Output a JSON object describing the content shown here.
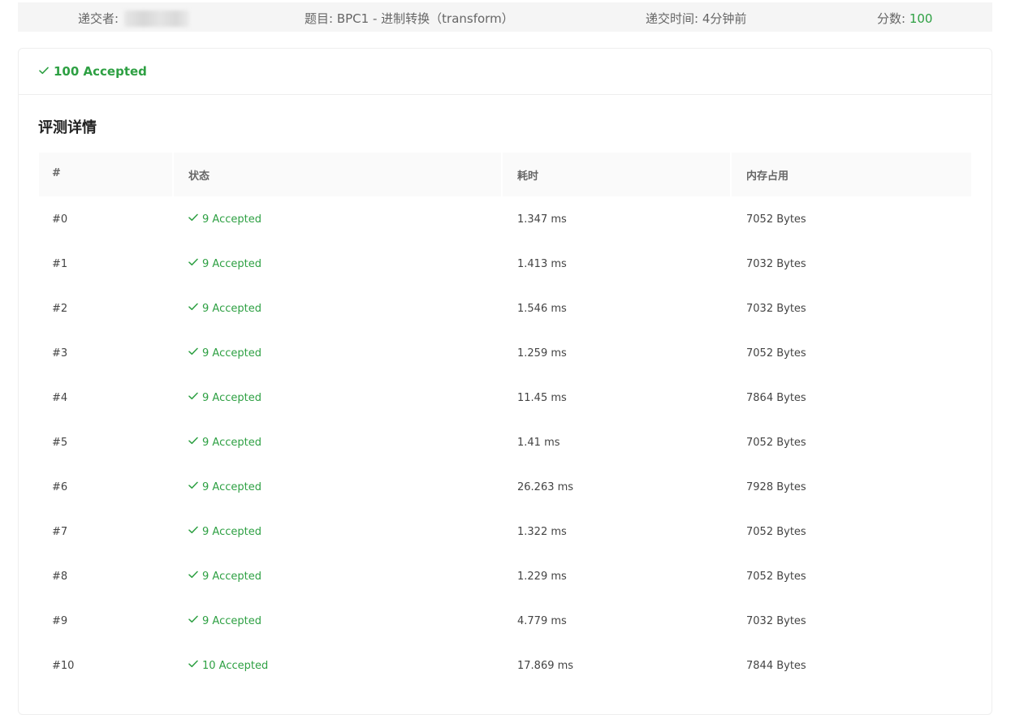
{
  "header": {
    "submitter_label": "递交者:",
    "problem_label": "题目:",
    "problem_name": "BPC1 - 进制转换（transform）",
    "time_label": "递交时间:",
    "time_value": "4分钟前",
    "score_label": "分数:",
    "score_value": "100"
  },
  "result": {
    "status": "100 Accepted"
  },
  "details": {
    "title": "评测详情",
    "columns": [
      "#",
      "状态",
      "耗时",
      "内存占用"
    ],
    "rows": [
      {
        "id": "#0",
        "status": "9 Accepted",
        "time": "1.347 ms",
        "memory": "7052 Bytes"
      },
      {
        "id": "#1",
        "status": "9 Accepted",
        "time": "1.413 ms",
        "memory": "7032 Bytes"
      },
      {
        "id": "#2",
        "status": "9 Accepted",
        "time": "1.546 ms",
        "memory": "7032 Bytes"
      },
      {
        "id": "#3",
        "status": "9 Accepted",
        "time": "1.259 ms",
        "memory": "7052 Bytes"
      },
      {
        "id": "#4",
        "status": "9 Accepted",
        "time": "11.45 ms",
        "memory": "7864 Bytes"
      },
      {
        "id": "#5",
        "status": "9 Accepted",
        "time": "1.41 ms",
        "memory": "7052 Bytes"
      },
      {
        "id": "#6",
        "status": "9 Accepted",
        "time": "26.263 ms",
        "memory": "7928 Bytes"
      },
      {
        "id": "#7",
        "status": "9 Accepted",
        "time": "1.322 ms",
        "memory": "7052 Bytes"
      },
      {
        "id": "#8",
        "status": "9 Accepted",
        "time": "1.229 ms",
        "memory": "7052 Bytes"
      },
      {
        "id": "#9",
        "status": "9 Accepted",
        "time": "4.779 ms",
        "memory": "7032 Bytes"
      },
      {
        "id": "#10",
        "status": "10 Accepted",
        "time": "17.869 ms",
        "memory": "7844 Bytes"
      }
    ]
  },
  "icons": {
    "check": "check-icon"
  },
  "colors": {
    "accent_green": "#2ea043",
    "header_bg": "#f5f5f5"
  }
}
